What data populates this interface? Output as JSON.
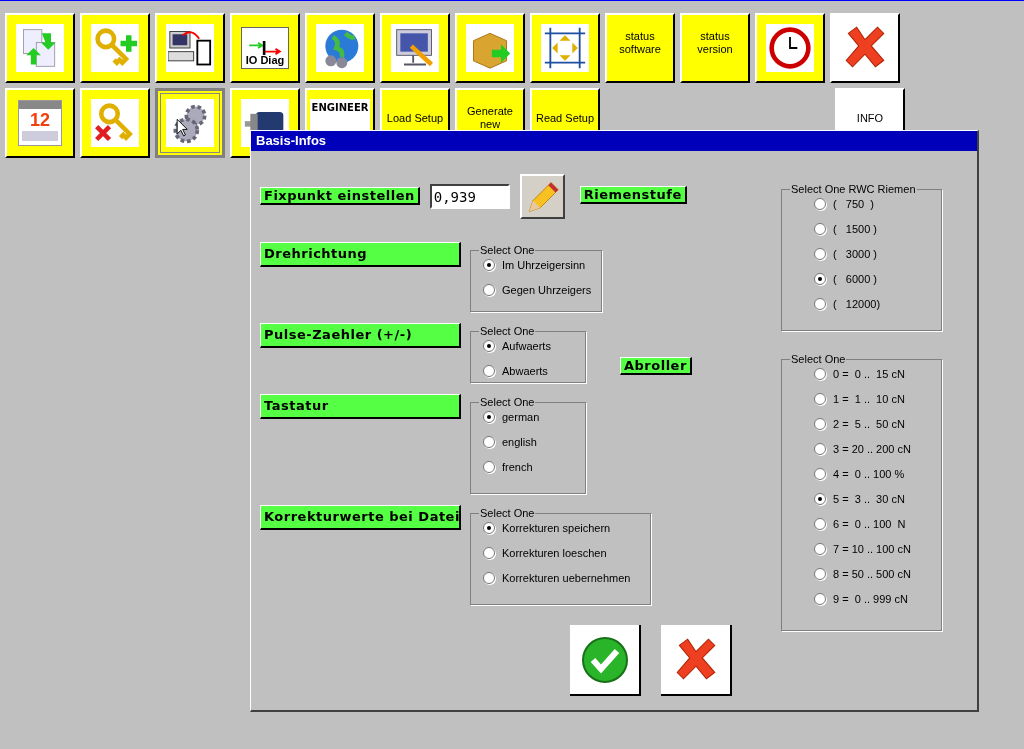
{
  "toolbar": {
    "rows": [
      {
        "buttons": [
          {
            "kind": "icon",
            "color": "#ffff00",
            "pressed": false
          },
          {
            "kind": "icon",
            "color": "#ffff00",
            "pressed": false
          },
          {
            "kind": "icon",
            "color": "#ffff00",
            "pressed": false
          },
          {
            "kind": "icon_label",
            "label": "IO Diag",
            "color": "#ffff00",
            "pressed": false
          },
          {
            "kind": "icon",
            "color": "#ffff00",
            "pressed": false
          },
          {
            "kind": "icon",
            "color": "#ffff00",
            "pressed": false
          },
          {
            "kind": "icon",
            "color": "#ffff00",
            "pressed": false
          },
          {
            "kind": "icon",
            "color": "#ffff00",
            "pressed": false
          },
          {
            "kind": "label",
            "label": "status software",
            "color": "#ffff00",
            "pressed": false
          },
          {
            "kind": "label",
            "label": "status version",
            "color": "#ffff00",
            "pressed": false
          },
          {
            "kind": "icon",
            "color": "#ffff00",
            "pressed": false
          },
          {
            "kind": "icon",
            "color": "#ffffff",
            "pressed": false
          }
        ],
        "end_buttons": []
      },
      {
        "buttons": [
          {
            "kind": "icon_label",
            "label": "12",
            "color": "#ffff00",
            "pressed": false
          },
          {
            "kind": "icon",
            "color": "#ffff00",
            "pressed": false
          },
          {
            "kind": "icon",
            "color": "#ffff00",
            "pressed": true
          },
          {
            "kind": "icon",
            "color": "#ffff00",
            "pressed": false
          },
          {
            "kind": "icon_label",
            "label": "ENGINEER",
            "color": "#ffff00",
            "pressed": false
          },
          {
            "kind": "label",
            "label": "Load Setup",
            "color": "#ffff00",
            "pressed": false
          },
          {
            "kind": "label",
            "label": "Generate new",
            "color": "#ffff00",
            "pressed": false
          },
          {
            "kind": "label",
            "label": "Read Setup",
            "color": "#ffff00",
            "pressed": false
          }
        ],
        "end_buttons": [
          {
            "kind": "label",
            "label": "INFO",
            "color": "#ffffff",
            "pressed": false
          }
        ]
      }
    ]
  },
  "dialog": {
    "title": "Basis-Infos",
    "fixpunkt": {
      "label": "Fixpunkt einstellen",
      "value": "0,939"
    },
    "left_groups": [
      {
        "label": "Drehrichtung",
        "legend": "Select One",
        "options": [
          {
            "text": "Im Uhrzeigersinn",
            "selected": true
          },
          {
            "text": "Gegen Uhrzeigers",
            "selected": false
          }
        ]
      },
      {
        "label": "Pulse-Zaehler (+/-)",
        "legend": "Select One",
        "options": [
          {
            "text": "Aufwaerts",
            "selected": true
          },
          {
            "text": "Abwaerts",
            "selected": false
          }
        ]
      },
      {
        "label": "Tastatur",
        "legend": "Select One",
        "options": [
          {
            "text": "german",
            "selected": true
          },
          {
            "text": "english",
            "selected": false
          },
          {
            "text": "french",
            "selected": false
          }
        ]
      },
      {
        "label": "Korrekturwerte bei Datei",
        "legend": "Select One",
        "options": [
          {
            "text": "Korrekturen speichern",
            "selected": true
          },
          {
            "text": "Korrekturen loeschen",
            "selected": false
          },
          {
            "text": "Korrekturen uebernehmen",
            "selected": false
          }
        ]
      }
    ],
    "right_groups": [
      {
        "label": "Riemenstufe",
        "legend": "Select One RWC Riemen",
        "options": [
          {
            "text": "(   750  )",
            "selected": false
          },
          {
            "text": "(   1500 )",
            "selected": false
          },
          {
            "text": "(   3000 )",
            "selected": false
          },
          {
            "text": "(   6000 )",
            "selected": true
          },
          {
            "text": "(   12000)",
            "selected": false
          }
        ]
      },
      {
        "label": "Abroller",
        "legend": "Select One",
        "options": [
          {
            "text": "0 =  0 ..  15 cN",
            "selected": false
          },
          {
            "text": "1 =  1 ..  10 cN",
            "selected": false
          },
          {
            "text": "2 =  5 ..  50 cN",
            "selected": false
          },
          {
            "text": "3 = 20 .. 200 cN",
            "selected": false
          },
          {
            "text": "4 =  0 .. 100 %",
            "selected": false
          },
          {
            "text": "5 =  3 ..  30 cN",
            "selected": true
          },
          {
            "text": "6 =  0 .. 100  N",
            "selected": false
          },
          {
            "text": "7 = 10 .. 100 cN",
            "selected": false
          },
          {
            "text": "8 = 50 .. 500 cN",
            "selected": false
          },
          {
            "text": "9 =  0 .. 999 cN",
            "selected": false
          }
        ]
      }
    ]
  }
}
